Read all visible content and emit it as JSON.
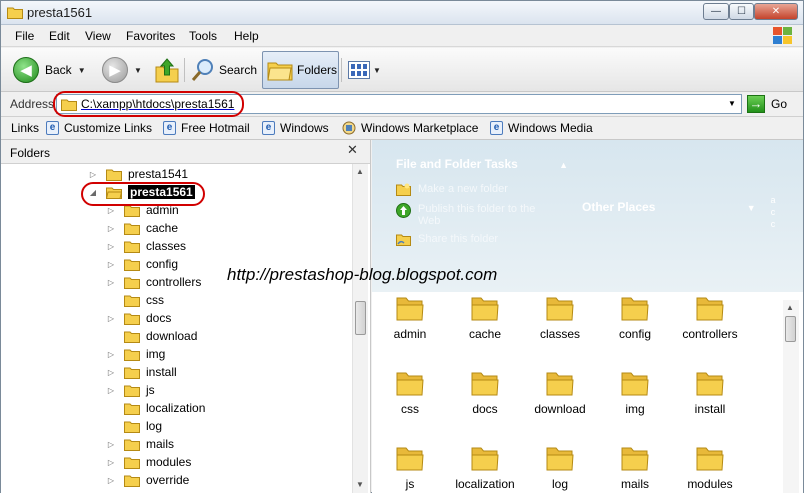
{
  "window": {
    "title": "presta1561",
    "controls": {
      "minimize": "—",
      "maximize": "☐",
      "close": "✕"
    }
  },
  "menu": [
    "File",
    "Edit",
    "View",
    "Favorites",
    "Tools",
    "Help"
  ],
  "toolbar": {
    "back_label": "Back",
    "search_label": "Search",
    "folders_label": "Folders"
  },
  "address": {
    "label": "Address",
    "value": "C:\\xampp\\htdocs\\presta1561",
    "go_label": "Go"
  },
  "links": {
    "label": "Links",
    "items": [
      "Customize Links",
      "Free Hotmail",
      "Windows",
      "Windows Marketplace",
      "Windows Media"
    ]
  },
  "folder_pane": {
    "title": "Folders",
    "close": "✕",
    "tree": [
      {
        "label": "presta1541",
        "expander": "▷",
        "level": 0
      },
      {
        "label": "presta1561",
        "expander": "◢",
        "level": 0,
        "selected": true
      },
      {
        "label": "admin",
        "expander": "▷",
        "level": 1
      },
      {
        "label": "cache",
        "expander": "▷",
        "level": 1
      },
      {
        "label": "classes",
        "expander": "▷",
        "level": 1
      },
      {
        "label": "config",
        "expander": "▷",
        "level": 1
      },
      {
        "label": "controllers",
        "expander": "▷",
        "level": 1
      },
      {
        "label": "css",
        "expander": "",
        "level": 1
      },
      {
        "label": "docs",
        "expander": "▷",
        "level": 1
      },
      {
        "label": "download",
        "expander": "",
        "level": 1
      },
      {
        "label": "img",
        "expander": "▷",
        "level": 1
      },
      {
        "label": "install",
        "expander": "▷",
        "level": 1
      },
      {
        "label": "js",
        "expander": "▷",
        "level": 1
      },
      {
        "label": "localization",
        "expander": "",
        "level": 1
      },
      {
        "label": "log",
        "expander": "",
        "level": 1
      },
      {
        "label": "mails",
        "expander": "▷",
        "level": 1
      },
      {
        "label": "modules",
        "expander": "▷",
        "level": 1
      },
      {
        "label": "override",
        "expander": "▷",
        "level": 1
      }
    ]
  },
  "task_pane": {
    "file_folder_tasks": "File and Folder Tasks",
    "tasks": [
      "Make a new folder",
      "Publish this folder to the Web",
      "Share this folder"
    ],
    "other_places": "Other Places"
  },
  "files": [
    "admin",
    "cache",
    "classes",
    "config",
    "controllers",
    "css",
    "docs",
    "download",
    "img",
    "install",
    "js",
    "localization",
    "log",
    "mails",
    "modules"
  ],
  "watermark": "http://prestashop-blog.blogspot.com",
  "colors": {
    "annotation_red": "#d10000",
    "folder_yellow": "#f5cf4d",
    "task_pane_blue": "#d7e6ef"
  }
}
